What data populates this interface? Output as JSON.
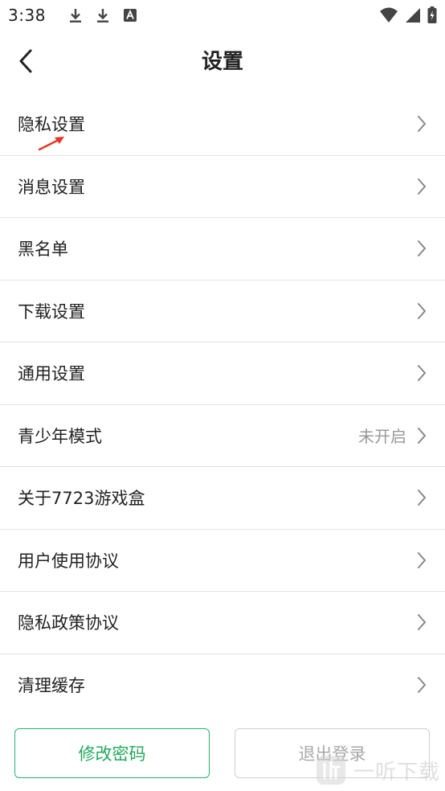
{
  "status_bar": {
    "time": "3:38",
    "left_icons": [
      "download-icon",
      "download-icon",
      "accessibility-a-icon"
    ],
    "right_icons": [
      "wifi-icon",
      "signal-icon",
      "battery-charging-icon"
    ]
  },
  "nav": {
    "title": "设置",
    "back_icon": "chevron-left-icon"
  },
  "settings": [
    {
      "label": "隐私设置",
      "value": ""
    },
    {
      "label": "消息设置",
      "value": ""
    },
    {
      "label": "黑名单",
      "value": ""
    },
    {
      "label": "下载设置",
      "value": ""
    },
    {
      "label": "通用设置",
      "value": ""
    },
    {
      "label": "青少年模式",
      "value": "未开启"
    },
    {
      "label": "关于7723游戏盒",
      "value": ""
    },
    {
      "label": "用户使用协议",
      "value": ""
    },
    {
      "label": "隐私政策协议",
      "value": ""
    },
    {
      "label": "清理缓存",
      "value": ""
    }
  ],
  "buttons": {
    "change_password": "修改密码",
    "logout": "退出登录"
  },
  "watermark": {
    "text": "一听下载"
  },
  "colors": {
    "accent_green": "#22a85f",
    "annotation_red": "#e8352b",
    "divider": "#e4e4e4",
    "muted_text": "#999999"
  }
}
